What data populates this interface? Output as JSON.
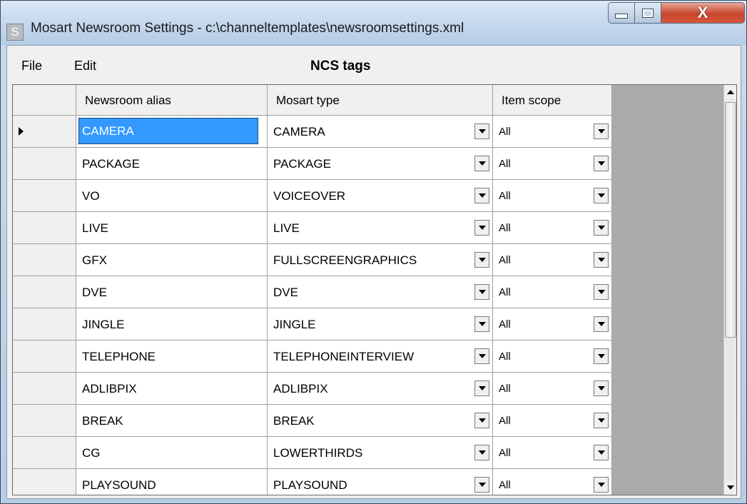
{
  "window": {
    "app_icon": "S",
    "title": "Mosart Newsroom Settings - c:\\channeltemplates\\newsroomsettings.xml",
    "controls": {
      "minimize": "minimize-icon",
      "maximize": "maximize-icon",
      "close": "close-icon"
    },
    "close_label": "X"
  },
  "menu": {
    "file": "File",
    "edit": "Edit"
  },
  "panel_title": "NCS tags",
  "grid": {
    "columns": [
      "Newsroom alias",
      "Mosart type",
      "Item scope"
    ],
    "selected_row": 0,
    "rows": [
      {
        "alias": "CAMERA",
        "type": "CAMERA",
        "scope": "All"
      },
      {
        "alias": "PACKAGE",
        "type": "PACKAGE",
        "scope": "All"
      },
      {
        "alias": "VO",
        "type": "VOICEOVER",
        "scope": "All"
      },
      {
        "alias": "LIVE",
        "type": "LIVE",
        "scope": "All"
      },
      {
        "alias": "GFX",
        "type": "FULLSCREENGRAPHICS",
        "scope": "All"
      },
      {
        "alias": "DVE",
        "type": "DVE",
        "scope": "All"
      },
      {
        "alias": "JINGLE",
        "type": "JINGLE",
        "scope": "All"
      },
      {
        "alias": "TELEPHONE",
        "type": "TELEPHONEINTERVIEW",
        "scope": "All"
      },
      {
        "alias": "ADLIBPIX",
        "type": "ADLIBPIX",
        "scope": "All"
      },
      {
        "alias": "BREAK",
        "type": "BREAK",
        "scope": "All"
      },
      {
        "alias": "CG",
        "type": "LOWERTHIRDS",
        "scope": "All"
      },
      {
        "alias": "PLAYSOUND",
        "type": "PLAYSOUND",
        "scope": "All"
      }
    ]
  }
}
